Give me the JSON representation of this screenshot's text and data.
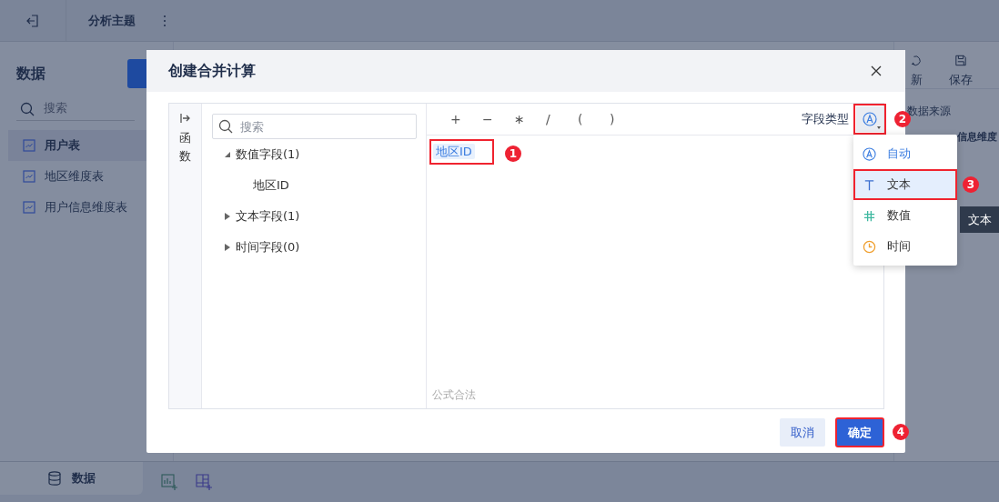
{
  "topbar": {
    "title": "分析主题"
  },
  "sidebar": {
    "title": "数据",
    "search": {
      "placeholder": "搜索"
    },
    "items": [
      {
        "label": "用户表",
        "selected": true
      },
      {
        "label": "地区维度表",
        "selected": false
      },
      {
        "label": "用户信息维度表",
        "selected": false
      }
    ]
  },
  "bottom_bar": {
    "tab": "数据"
  },
  "right_panel": {
    "tools": [
      {
        "kind": "refresh",
        "label": "新"
      },
      {
        "kind": "save",
        "label": "保存"
      }
    ],
    "section": "数据来源",
    "value": "信息维度"
  },
  "tooltip": "文本",
  "dialog": {
    "title": "创建合并计算",
    "side_tab": "函数",
    "search": {
      "placeholder": "搜索"
    },
    "tree": [
      {
        "label": "数值字段(1)",
        "expanded": true,
        "children": [
          {
            "label": "地区ID"
          }
        ]
      },
      {
        "label": "文本字段(1)",
        "expanded": false
      },
      {
        "label": "时间字段(0)",
        "expanded": false
      }
    ],
    "operators": [
      "+",
      "−",
      "∗",
      "/",
      "(",
      ")"
    ],
    "field_type_label": "字段类型",
    "field_type_callout": "2",
    "formula_tokens": [
      {
        "text": "地区ID",
        "callout": "1"
      }
    ],
    "status": "公式合法",
    "type_menu": [
      {
        "kind": "auto",
        "label": "自动",
        "selected": false
      },
      {
        "kind": "text",
        "label": "文本",
        "selected": true,
        "callout": "3"
      },
      {
        "kind": "number",
        "label": "数值",
        "selected": false
      },
      {
        "kind": "time",
        "label": "时间",
        "selected": false
      }
    ],
    "buttons": [
      {
        "kind": "secondary",
        "label": "取消"
      },
      {
        "kind": "primary",
        "label": "确定",
        "callout": "4"
      }
    ]
  }
}
